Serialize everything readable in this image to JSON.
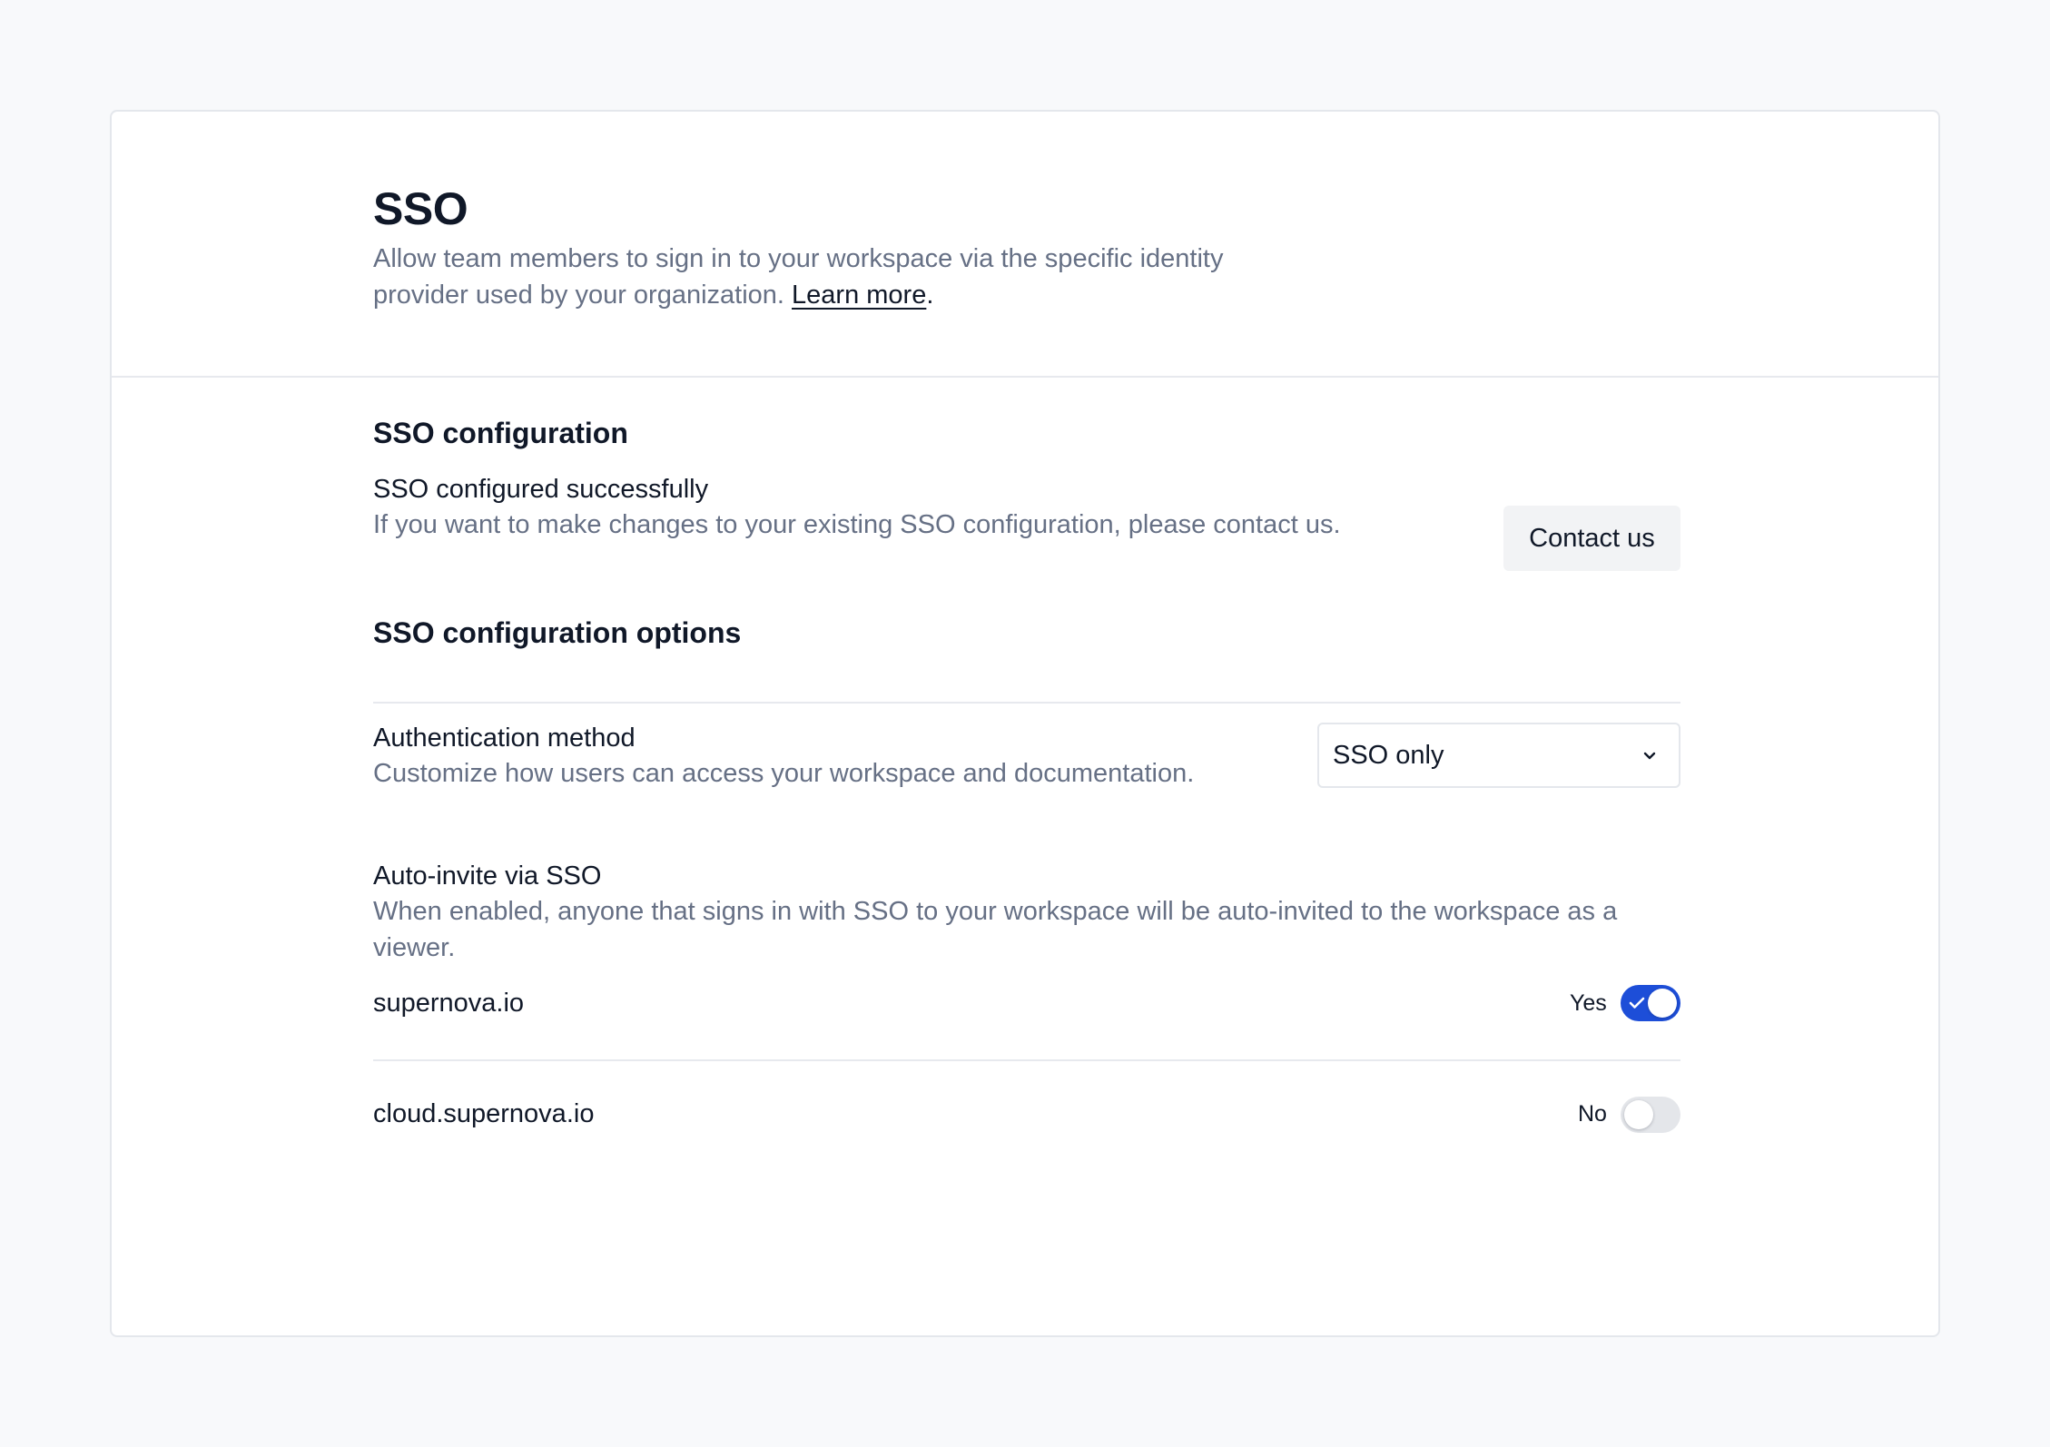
{
  "header": {
    "title": "SSO",
    "description": "Allow team members to sign in to your workspace via the specific identity provider used by your organization. ",
    "learn_more": "Learn more",
    "period": "."
  },
  "sso_configuration": {
    "title": "SSO configuration",
    "status_title": "SSO configured successfully",
    "status_description": "If you want to make changes to your existing SSO configuration, please contact us.",
    "contact_label": "Contact us"
  },
  "options": {
    "title": "SSO configuration options",
    "auth_method": {
      "title": "Authentication method",
      "description": "Customize how users can access your workspace and documentation.",
      "selected": "SSO only",
      "icon": "chevron-down-icon"
    },
    "auto_invite": {
      "title": "Auto-invite via SSO",
      "description": "When enabled, anyone that signs in with SSO to your workspace will be auto-invited to the workspace as a viewer.",
      "domains": [
        {
          "name": "supernova.io",
          "enabled": true,
          "label": "Yes"
        },
        {
          "name": "cloud.supernova.io",
          "enabled": false,
          "label": "No"
        }
      ]
    }
  },
  "colors": {
    "accent": "#1d4ed8",
    "muted_text": "#667085",
    "border": "#e4e7ec"
  }
}
